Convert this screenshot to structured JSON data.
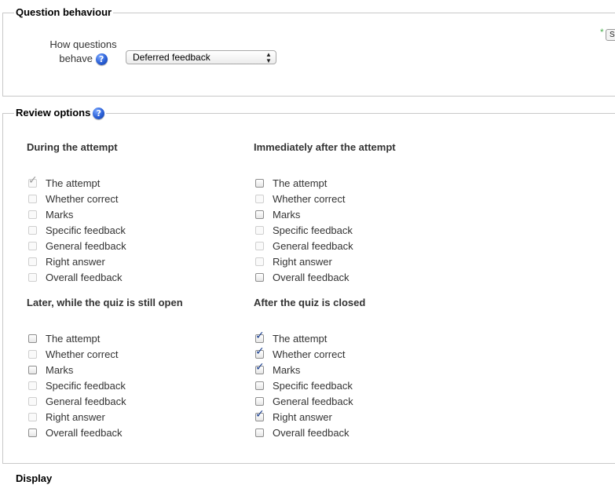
{
  "question_behaviour": {
    "legend": "Question behaviour",
    "how_label": "How questions behave",
    "select_value": "Deferred feedback",
    "required_marker": "*",
    "cut_button": "S"
  },
  "review_options": {
    "legend": "Review options",
    "groups": [
      {
        "title": "During the attempt",
        "options": [
          {
            "label": "The attempt",
            "checked": true,
            "disabled": true
          },
          {
            "label": "Whether correct",
            "checked": false,
            "disabled": true
          },
          {
            "label": "Marks",
            "checked": false,
            "disabled": true
          },
          {
            "label": "Specific feedback",
            "checked": false,
            "disabled": true
          },
          {
            "label": "General feedback",
            "checked": false,
            "disabled": true
          },
          {
            "label": "Right answer",
            "checked": false,
            "disabled": true
          },
          {
            "label": "Overall feedback",
            "checked": false,
            "disabled": true
          }
        ]
      },
      {
        "title": "Immediately after the attempt",
        "options": [
          {
            "label": "The attempt",
            "checked": false,
            "disabled": false
          },
          {
            "label": "Whether correct",
            "checked": false,
            "disabled": true
          },
          {
            "label": "Marks",
            "checked": false,
            "disabled": false
          },
          {
            "label": "Specific feedback",
            "checked": false,
            "disabled": true
          },
          {
            "label": "General feedback",
            "checked": false,
            "disabled": true
          },
          {
            "label": "Right answer",
            "checked": false,
            "disabled": true
          },
          {
            "label": "Overall feedback",
            "checked": false,
            "disabled": false
          }
        ]
      },
      {
        "title": "Later, while the quiz is still open",
        "options": [
          {
            "label": "The attempt",
            "checked": false,
            "disabled": false
          },
          {
            "label": "Whether correct",
            "checked": false,
            "disabled": true
          },
          {
            "label": "Marks",
            "checked": false,
            "disabled": false
          },
          {
            "label": "Specific feedback",
            "checked": false,
            "disabled": true
          },
          {
            "label": "General feedback",
            "checked": false,
            "disabled": true
          },
          {
            "label": "Right answer",
            "checked": false,
            "disabled": true
          },
          {
            "label": "Overall feedback",
            "checked": false,
            "disabled": false
          }
        ]
      },
      {
        "title": "After the quiz is closed",
        "options": [
          {
            "label": "The attempt",
            "checked": true,
            "disabled": false
          },
          {
            "label": "Whether correct",
            "checked": true,
            "disabled": false
          },
          {
            "label": "Marks",
            "checked": true,
            "disabled": false
          },
          {
            "label": "Specific feedback",
            "checked": false,
            "disabled": false
          },
          {
            "label": "General feedback",
            "checked": false,
            "disabled": false
          },
          {
            "label": "Right answer",
            "checked": true,
            "disabled": false
          },
          {
            "label": "Overall feedback",
            "checked": false,
            "disabled": false
          }
        ]
      }
    ]
  },
  "next_section_cut": "Display",
  "icons": {
    "help": "help-icon",
    "check": "checkmark-icon",
    "select_arrows": "updown-arrows-icon"
  },
  "colors": {
    "check_active": "#1a3f8f",
    "check_disabled": "#9a9a9a",
    "help_icon": "#2a5fd6",
    "required_star": "#4caf50"
  }
}
